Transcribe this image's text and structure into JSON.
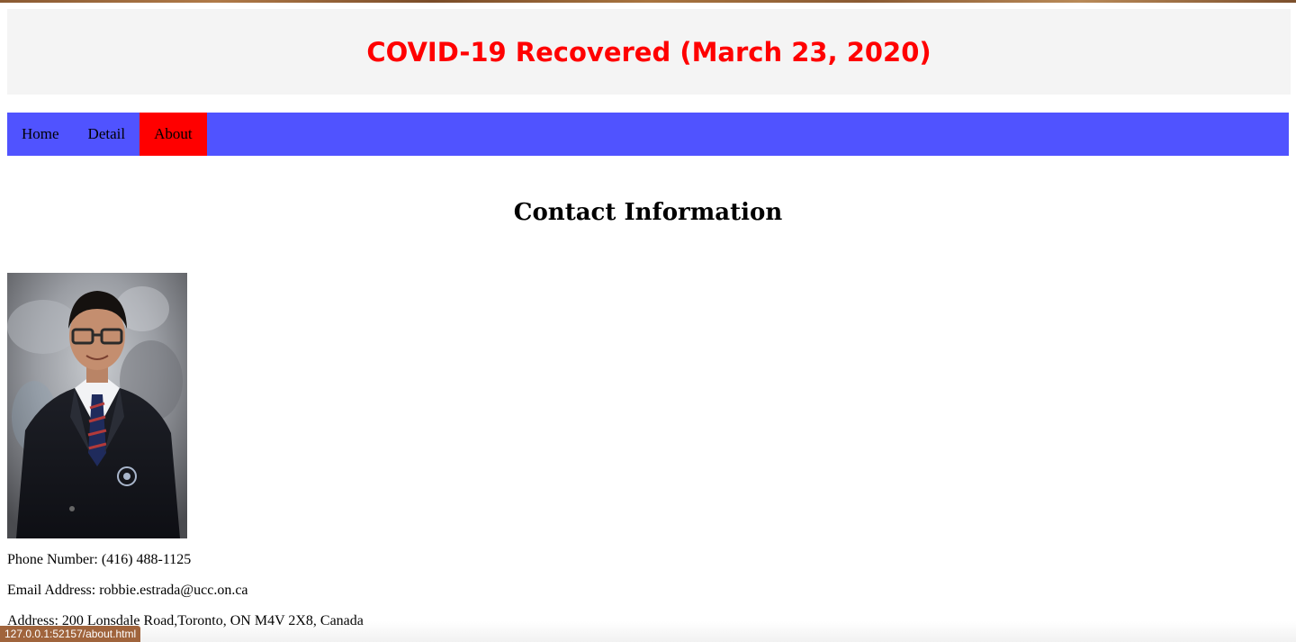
{
  "header": {
    "title": "COVID-19 Recovered (March 23, 2020)"
  },
  "nav": {
    "items": [
      {
        "label": "Home",
        "active": false
      },
      {
        "label": "Detail",
        "active": false
      },
      {
        "label": "About",
        "active": true
      }
    ]
  },
  "main": {
    "heading": "Contact Information",
    "photo_alt": "Portrait of student in school blazer",
    "phone": "Phone Number: (416) 488-1125",
    "email": "Email Address: robbie.estrada@ucc.on.ca",
    "address": "Address: 200 Lonsdale Road,Toronto, ON M4V 2X8, Canada"
  },
  "status_bar": {
    "url": "127.0.0.1:52157/about.html"
  },
  "colors": {
    "title": "#ff0000",
    "header_bg": "#f4f4f4",
    "nav_bg": "#5053ff",
    "nav_active": "#ff0000",
    "status_bg": "#a0643c"
  }
}
